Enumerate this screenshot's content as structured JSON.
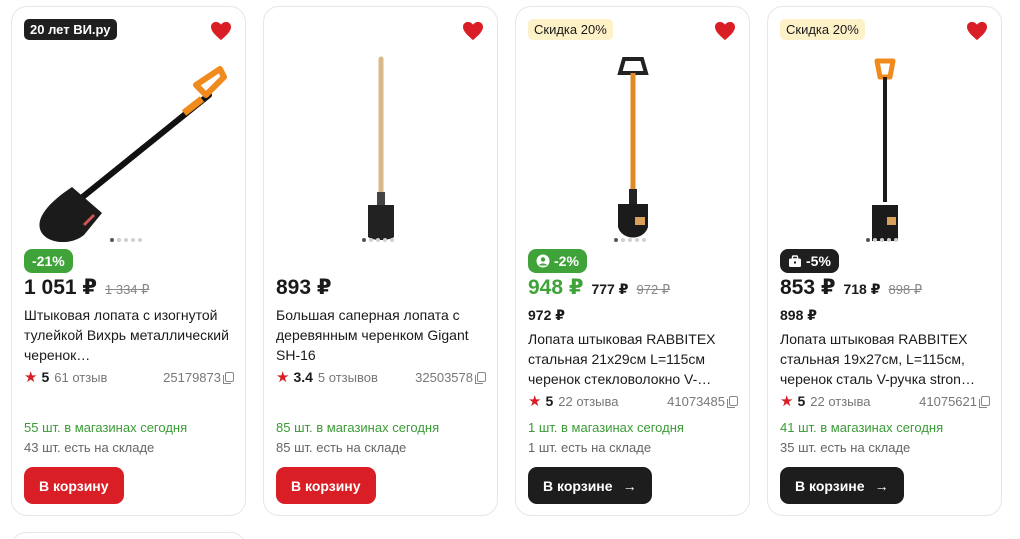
{
  "products": [
    {
      "badge_top": "20 лет ВИ.ру",
      "discount": "-21%",
      "price": "1 051 ₽",
      "old_price": "1 334 ₽",
      "title": "Штыковая лопата с изогнутой тулейкой Вихрь металлический черенок…",
      "rating": "5",
      "reviews": "61 отзыв",
      "code": "25179873",
      "stock_shop": "55 шт. в магазинах сегодня",
      "stock_warehouse": "43 шт. есть на складе",
      "button": "В корзину"
    },
    {
      "price": "893 ₽",
      "title": "Большая саперная лопата с деревянным черенком Gigant SH-16",
      "rating": "3.4",
      "reviews": "5 отзывов",
      "code": "32503578",
      "stock_shop": "85 шт. в магазинах сегодня",
      "stock_warehouse": "85 шт. есть на складе",
      "button": "В корзину"
    },
    {
      "badge_top": "Скидка 20%",
      "discount": "-2%",
      "price": "948 ₽",
      "mid_price": "777 ₽",
      "old_price": "972 ₽",
      "sub_price": "972 ₽",
      "title": "Лопата штыковая RABBITEX стальная 21x29см L=115см черенок стекловолокно V-…",
      "rating": "5",
      "reviews": "22 отзыва",
      "code": "41073485",
      "stock_shop": "1 шт. в магазинах сегодня",
      "stock_warehouse": "1 шт. есть на складе",
      "button": "В корзине"
    },
    {
      "badge_top": "Скидка 20%",
      "discount": "-5%",
      "price": "853 ₽",
      "mid_price": "718 ₽",
      "old_price": "898 ₽",
      "sub_price": "898 ₽",
      "title": "Лопата штыковая RABBITEX стальная 19x27см, L=115см, черенок сталь V-ручка stron…",
      "rating": "5",
      "reviews": "22 отзыва",
      "code": "41075621",
      "stock_shop": "41 шт. в магазинах сегодня",
      "stock_warehouse": "35 шт. есть на складе",
      "button": "В корзине"
    }
  ],
  "icons": {
    "favorite": "heart-icon",
    "rating": "star-icon",
    "copy": "copy-icon",
    "cart_arrow": "arrow-right-icon",
    "discount_user": "user-circle-icon",
    "discount_business": "briefcase-icon"
  },
  "colors": {
    "accent_red": "#d91e26",
    "sale_green": "#3fa33a",
    "dark": "#1d1d1d",
    "badge_yellow": "#fdf1c7"
  }
}
